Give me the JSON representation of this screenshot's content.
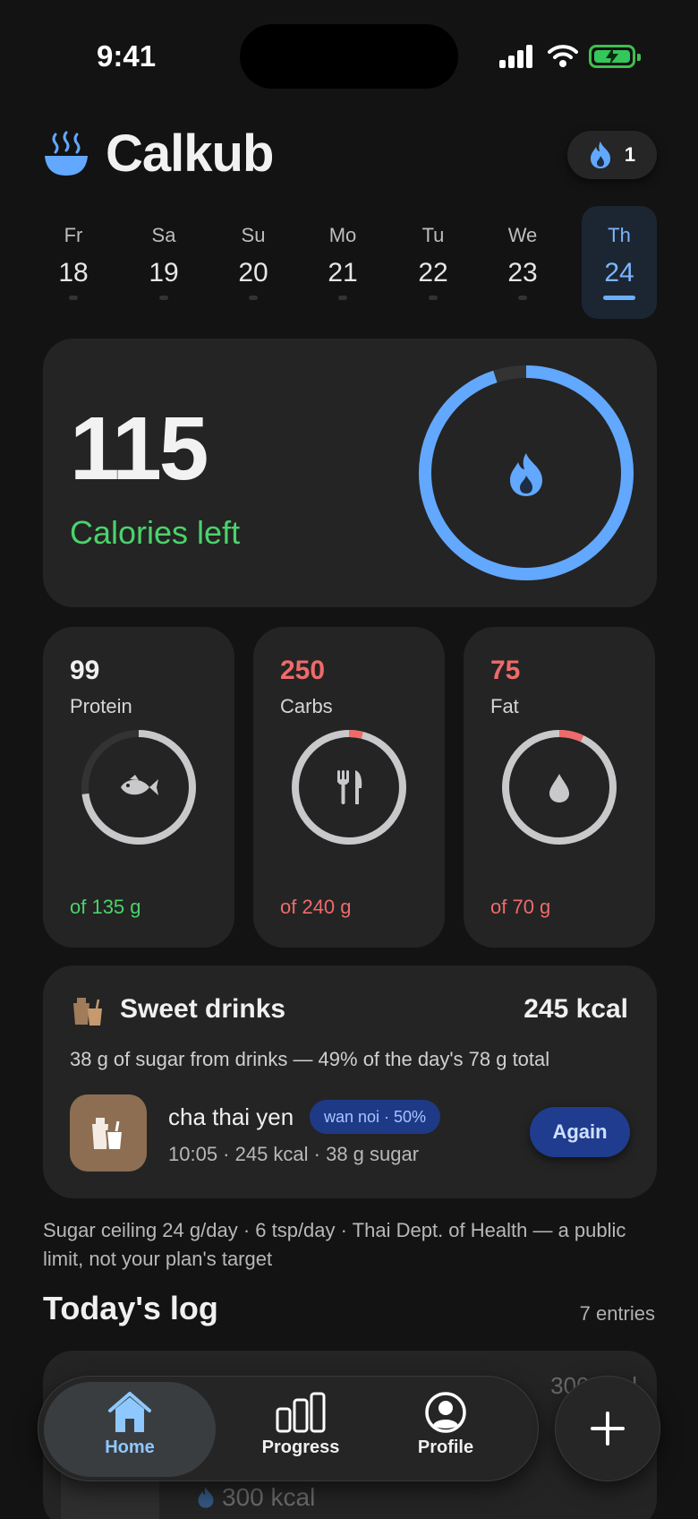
{
  "status_bar": {
    "time": "9:41"
  },
  "app": {
    "name": "Calkub",
    "streak": "1"
  },
  "week": [
    {
      "dow": "Fr",
      "date": "18"
    },
    {
      "dow": "Sa",
      "date": "19"
    },
    {
      "dow": "Su",
      "date": "20"
    },
    {
      "dow": "Mo",
      "date": "21"
    },
    {
      "dow": "Tu",
      "date": "22"
    },
    {
      "dow": "We",
      "date": "23"
    },
    {
      "dow": "Th",
      "date": "24",
      "selected": true
    }
  ],
  "calories": {
    "value": "115",
    "label": "Calories left",
    "ring_fraction": 0.95
  },
  "macros": [
    {
      "value": "99",
      "label": "Protein",
      "of": "of 135 g",
      "status": "under",
      "fraction": 0.73
    },
    {
      "value": "250",
      "label": "Carbs",
      "of": "of 240 g",
      "status": "over",
      "over_fraction": 0.04
    },
    {
      "value": "75",
      "label": "Fat",
      "of": "of 70 g",
      "status": "over",
      "over_fraction": 0.07
    }
  ],
  "sweet_drinks": {
    "title": "Sweet drinks",
    "kcal": "245 kcal",
    "summary": "38 g of sugar from drinks — 49% of the day's 78 g total",
    "item": {
      "name": "cha thai yen",
      "tag": "wan noi · 50%",
      "meta": "10:05 · 245 kcal · 38 g sugar",
      "action": "Again"
    }
  },
  "sugar_note": "Sugar ceiling 24 g/day · 6 tsp/day · Thai Dept. of Health — a public limit, not your plan's target",
  "log": {
    "title": "Today's log",
    "count": "7 entries",
    "first_entry_kcal": "300 kcal"
  },
  "tabs": {
    "home": "Home",
    "progress": "Progress",
    "profile": "Profile"
  },
  "colors": {
    "accent_blue": "#62a8ff",
    "good_green": "#4ad36b",
    "over_red": "#f06a6a",
    "ring_gray": "#c9c9cc"
  }
}
